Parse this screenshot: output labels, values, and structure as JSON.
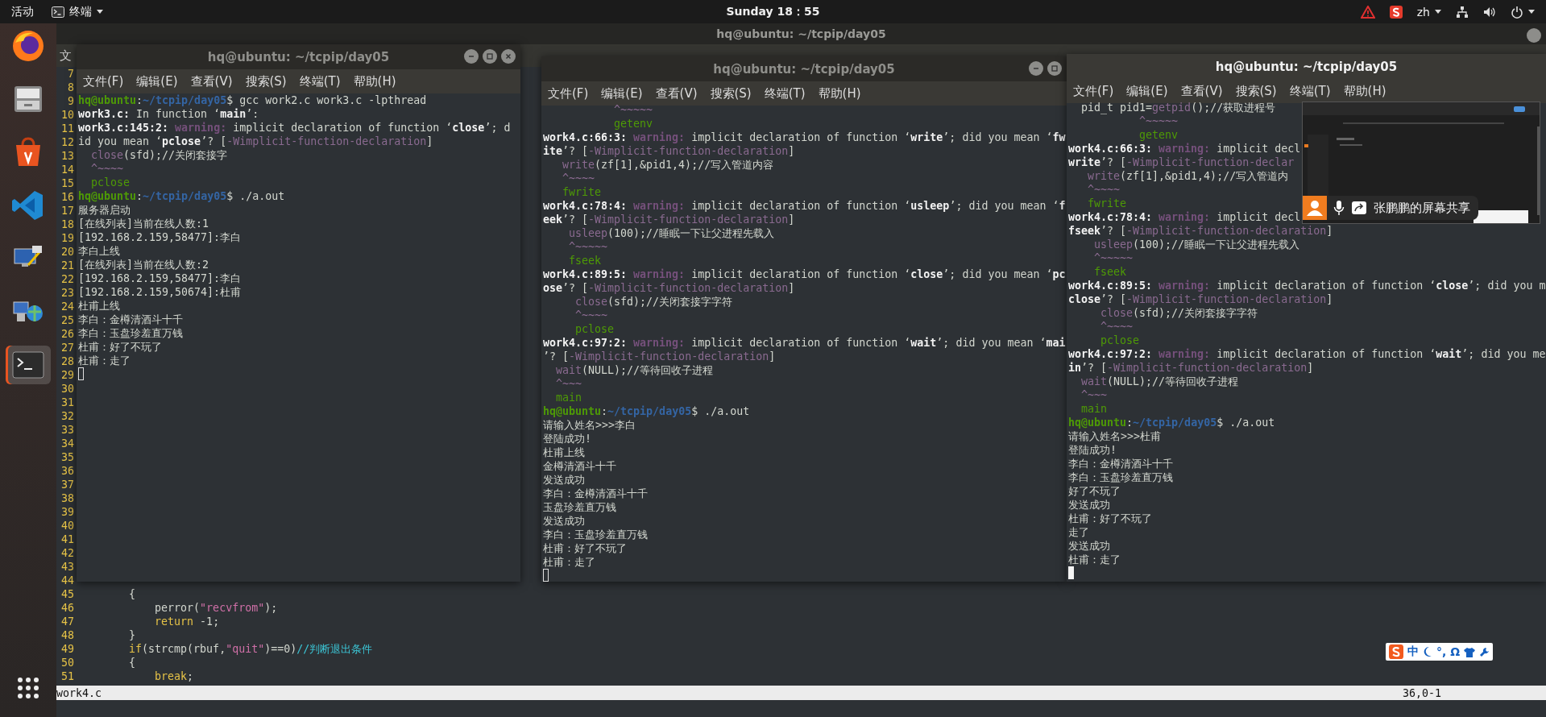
{
  "top_bar": {
    "activities": "活动",
    "app_name": "终端",
    "clock": "Sunday 18：55",
    "language": "zh"
  },
  "dock": [
    {
      "kind": "firefox",
      "running": false
    },
    {
      "kind": "files",
      "running": false
    },
    {
      "kind": "software",
      "running": false
    },
    {
      "kind": "vscode",
      "running": false
    },
    {
      "kind": "remote",
      "running": false
    },
    {
      "kind": "network",
      "running": false
    },
    {
      "kind": "terminal",
      "running": true
    }
  ],
  "editor": {
    "title": "hq@ubuntu: ~/tcpip/day05",
    "menu": [
      "文"
    ],
    "rows": [
      {
        "number": "7"
      },
      {
        "number": "8"
      },
      {
        "number": "9"
      },
      {
        "number": "10"
      },
      {
        "number": "11"
      },
      {
        "number": "12"
      },
      {
        "number": "13"
      },
      {
        "number": "14"
      },
      {
        "number": "15"
      },
      {
        "number": "16"
      },
      {
        "number": "17"
      },
      {
        "number": "18"
      },
      {
        "number": "19"
      },
      {
        "number": "20"
      },
      {
        "number": "21"
      },
      {
        "number": "22"
      },
      {
        "number": "23"
      },
      {
        "number": "24"
      },
      {
        "number": "25"
      },
      {
        "number": "26"
      },
      {
        "number": "27"
      },
      {
        "number": "28"
      },
      {
        "number": "29"
      },
      {
        "number": "30"
      },
      {
        "number": "31"
      },
      {
        "number": "32"
      },
      {
        "number": "33"
      },
      {
        "number": "34"
      },
      {
        "number": "35"
      },
      {
        "number": "36"
      },
      {
        "number": "37"
      },
      {
        "number": "38"
      },
      {
        "number": "39"
      },
      {
        "number": "40"
      },
      {
        "number": "41"
      },
      {
        "number": "42"
      },
      {
        "number": "43"
      },
      {
        "number": "44"
      },
      {
        "number": "45",
        "segments": [
          {
            "kind": "plain",
            "text": "        {"
          }
        ]
      },
      {
        "number": "46",
        "segments": [
          {
            "kind": "plain",
            "text": "            perror("
          },
          {
            "kind": "string",
            "text": "\"recvfrom\""
          },
          {
            "kind": "plain",
            "text": ");"
          }
        ]
      },
      {
        "number": "47",
        "segments": [
          {
            "kind": "keyword",
            "text": "            return"
          },
          {
            "kind": "plain",
            "text": " -1;"
          }
        ]
      },
      {
        "number": "48",
        "segments": [
          {
            "kind": "plain",
            "text": "        }"
          }
        ]
      },
      {
        "number": "49",
        "segments": [
          {
            "kind": "keyword",
            "text": "        if"
          },
          {
            "kind": "plain",
            "text": "(strcmp(rbuf,"
          },
          {
            "kind": "string",
            "text": "\"quit\""
          },
          {
            "kind": "plain",
            "text": ")==0)"
          },
          {
            "kind": "comment",
            "text": "//判断退出条件"
          }
        ]
      },
      {
        "number": "50",
        "segments": [
          {
            "kind": "plain",
            "text": "        {"
          }
        ]
      },
      {
        "number": "51",
        "segments": [
          {
            "kind": "keyword",
            "text": "            break"
          },
          {
            "kind": "plain",
            "text": ";"
          }
        ]
      }
    ],
    "status": {
      "file": "work4.c",
      "position": "36,0-1"
    }
  },
  "terminals": [
    {
      "title": "hq@ubuntu: ~/tcpip/day05",
      "active": false,
      "menu": [
        "文件(F)",
        "编辑(E)",
        "查看(V)",
        "搜索(S)",
        "终端(T)",
        "帮助(H)"
      ],
      "cursor_focused": false,
      "lines": [
        {
          "segments": [
            {
              "kind": "user",
              "text": "hq@ubuntu"
            },
            {
              "kind": "plain",
              "text": ":"
            },
            {
              "kind": "path",
              "text": "~/tcpip/day05"
            },
            {
              "kind": "plain",
              "text": "$ gcc work2.c work3.c -lpthread"
            }
          ]
        },
        {
          "segments": [
            {
              "kind": "bold",
              "text": "work3.c:"
            },
            {
              "kind": "plain",
              "text": " In function ‘"
            },
            {
              "kind": "bold",
              "text": "main"
            },
            {
              "kind": "plain",
              "text": "’:"
            }
          ]
        },
        {
          "segments": [
            {
              "kind": "bold",
              "text": "work3.c:145:2: "
            },
            {
              "kind": "warning",
              "text": "warning:"
            },
            {
              "kind": "plain",
              "text": " implicit declaration of function ‘"
            },
            {
              "kind": "bold",
              "text": "close"
            },
            {
              "kind": "plain",
              "text": "’; d"
            }
          ]
        },
        {
          "segments": [
            {
              "kind": "plain",
              "text": "id you mean ‘"
            },
            {
              "kind": "bold",
              "text": "pclose"
            },
            {
              "kind": "plain",
              "text": "’? ["
            },
            {
              "kind": "flag",
              "text": "-Wimplicit-function-declaration"
            },
            {
              "kind": "plain",
              "text": "]"
            }
          ]
        },
        {
          "segments": [
            {
              "kind": "flag",
              "text": "  close"
            },
            {
              "kind": "plain",
              "text": "(sfd);//关闭套接字"
            }
          ]
        },
        {
          "segments": [
            {
              "kind": "flag",
              "text": "  ^~~~~"
            }
          ]
        },
        {
          "segments": [
            {
              "kind": "hint",
              "text": "  pclose"
            }
          ]
        },
        {
          "segments": [
            {
              "kind": "user",
              "text": "hq@ubuntu"
            },
            {
              "kind": "plain",
              "text": ":"
            },
            {
              "kind": "path",
              "text": "~/tcpip/day05"
            },
            {
              "kind": "plain",
              "text": "$ ./a.out"
            }
          ]
        },
        {
          "segments": [
            {
              "kind": "plain",
              "text": "服务器启动"
            }
          ]
        },
        {
          "segments": [
            {
              "kind": "plain",
              "text": "[在线列表]当前在线人数:1"
            }
          ]
        },
        {
          "segments": [
            {
              "kind": "plain",
              "text": "[192.168.2.159,58477]:李白"
            }
          ]
        },
        {
          "segments": [
            {
              "kind": "plain",
              "text": "李白上线"
            }
          ]
        },
        {
          "segments": [
            {
              "kind": "plain",
              "text": "[在线列表]当前在线人数:2"
            }
          ]
        },
        {
          "segments": [
            {
              "kind": "plain",
              "text": "[192.168.2.159,58477]:李白"
            }
          ]
        },
        {
          "segments": [
            {
              "kind": "plain",
              "text": "[192.168.2.159,50674]:杜甫"
            }
          ]
        },
        {
          "segments": [
            {
              "kind": "plain",
              "text": "杜甫上线"
            }
          ]
        },
        {
          "segments": [
            {
              "kind": "plain",
              "text": "李白：金樽清酒斗十千"
            }
          ]
        },
        {
          "segments": [
            {
              "kind": "plain",
              "text": "李白：玉盘珍羞直万钱"
            }
          ]
        },
        {
          "segments": [
            {
              "kind": "plain",
              "text": "杜甫：好了不玩了"
            }
          ]
        },
        {
          "segments": [
            {
              "kind": "plain",
              "text": "杜甫：走了"
            }
          ]
        }
      ]
    },
    {
      "title": "hq@ubuntu: ~/tcpip/day05",
      "active": false,
      "menu": [
        "文件(F)",
        "编辑(E)",
        "查看(V)",
        "搜索(S)",
        "终端(T)",
        "帮助(H)"
      ],
      "cursor_focused": false,
      "lines": [
        {
          "segments": [
            {
              "kind": "flag",
              "text": "           ^~~~~~"
            }
          ]
        },
        {
          "segments": [
            {
              "kind": "hint",
              "text": "           getenv"
            }
          ]
        },
        {
          "segments": [
            {
              "kind": "bold",
              "text": "work4.c:66:3: "
            },
            {
              "kind": "warning",
              "text": "warning:"
            },
            {
              "kind": "plain",
              "text": " implicit declaration of function ‘"
            },
            {
              "kind": "bold",
              "text": "write"
            },
            {
              "kind": "plain",
              "text": "’; did you mean ‘"
            },
            {
              "kind": "bold",
              "text": "fw"
            }
          ]
        },
        {
          "segments": [
            {
              "kind": "bold",
              "text": "ite"
            },
            {
              "kind": "plain",
              "text": "’? ["
            },
            {
              "kind": "flag",
              "text": "-Wimplicit-function-declaration"
            },
            {
              "kind": "plain",
              "text": "]"
            }
          ]
        },
        {
          "segments": [
            {
              "kind": "flag",
              "text": "   write"
            },
            {
              "kind": "plain",
              "text": "(zf[1],&pid1,4);//写入管道内容"
            }
          ]
        },
        {
          "segments": [
            {
              "kind": "flag",
              "text": "   ^~~~~"
            }
          ]
        },
        {
          "segments": [
            {
              "kind": "hint",
              "text": "   fwrite"
            }
          ]
        },
        {
          "segments": [
            {
              "kind": "bold",
              "text": "work4.c:78:4: "
            },
            {
              "kind": "warning",
              "text": "warning:"
            },
            {
              "kind": "plain",
              "text": " implicit declaration of function ‘"
            },
            {
              "kind": "bold",
              "text": "usleep"
            },
            {
              "kind": "plain",
              "text": "’; did you mean ‘"
            },
            {
              "kind": "bold",
              "text": "f"
            }
          ]
        },
        {
          "segments": [
            {
              "kind": "bold",
              "text": "eek"
            },
            {
              "kind": "plain",
              "text": "’? ["
            },
            {
              "kind": "flag",
              "text": "-Wimplicit-function-declaration"
            },
            {
              "kind": "plain",
              "text": "]"
            }
          ]
        },
        {
          "segments": [
            {
              "kind": "flag",
              "text": "    usleep"
            },
            {
              "kind": "plain",
              "text": "(100);//睡眠一下让父进程先载入"
            }
          ]
        },
        {
          "segments": [
            {
              "kind": "flag",
              "text": "    ^~~~~~"
            }
          ]
        },
        {
          "segments": [
            {
              "kind": "hint",
              "text": "    fseek"
            }
          ]
        },
        {
          "segments": [
            {
              "kind": "bold",
              "text": "work4.c:89:5: "
            },
            {
              "kind": "warning",
              "text": "warning:"
            },
            {
              "kind": "plain",
              "text": " implicit declaration of function ‘"
            },
            {
              "kind": "bold",
              "text": "close"
            },
            {
              "kind": "plain",
              "text": "’; did you mean ‘"
            },
            {
              "kind": "bold",
              "text": "pc"
            }
          ]
        },
        {
          "segments": [
            {
              "kind": "bold",
              "text": "ose"
            },
            {
              "kind": "plain",
              "text": "’? ["
            },
            {
              "kind": "flag",
              "text": "-Wimplicit-function-declaration"
            },
            {
              "kind": "plain",
              "text": "]"
            }
          ]
        },
        {
          "segments": [
            {
              "kind": "flag",
              "text": "     close"
            },
            {
              "kind": "plain",
              "text": "(sfd);//关闭套接字字符"
            }
          ]
        },
        {
          "segments": [
            {
              "kind": "flag",
              "text": "     ^~~~~"
            }
          ]
        },
        {
          "segments": [
            {
              "kind": "hint",
              "text": "     pclose"
            }
          ]
        },
        {
          "segments": [
            {
              "kind": "bold",
              "text": "work4.c:97:2: "
            },
            {
              "kind": "warning",
              "text": "warning:"
            },
            {
              "kind": "plain",
              "text": " implicit declaration of function ‘"
            },
            {
              "kind": "bold",
              "text": "wait"
            },
            {
              "kind": "plain",
              "text": "’; did you mean ‘"
            },
            {
              "kind": "bold",
              "text": "mai"
            }
          ]
        },
        {
          "segments": [
            {
              "kind": "plain",
              "text": "’? ["
            },
            {
              "kind": "flag",
              "text": "-Wimplicit-function-declaration"
            },
            {
              "kind": "plain",
              "text": "]"
            }
          ]
        },
        {
          "segments": [
            {
              "kind": "flag",
              "text": "  wait"
            },
            {
              "kind": "plain",
              "text": "(NULL);//等待回收子进程"
            }
          ]
        },
        {
          "segments": [
            {
              "kind": "flag",
              "text": "  ^~~~"
            }
          ]
        },
        {
          "segments": [
            {
              "kind": "hint",
              "text": "  main"
            }
          ]
        },
        {
          "segments": [
            {
              "kind": "user",
              "text": "hq@ubuntu"
            },
            {
              "kind": "plain",
              "text": ":"
            },
            {
              "kind": "path",
              "text": "~/tcpip/day05"
            },
            {
              "kind": "plain",
              "text": "$ ./a.out"
            }
          ]
        },
        {
          "segments": [
            {
              "kind": "plain",
              "text": "请输入姓名>>>李白"
            }
          ]
        },
        {
          "segments": [
            {
              "kind": "plain",
              "text": "登陆成功!"
            }
          ]
        },
        {
          "segments": [
            {
              "kind": "plain",
              "text": "杜甫上线"
            }
          ]
        },
        {
          "segments": [
            {
              "kind": "plain",
              "text": "金樽清酒斗十千"
            }
          ]
        },
        {
          "segments": [
            {
              "kind": "plain",
              "text": "发送成功"
            }
          ]
        },
        {
          "segments": [
            {
              "kind": "plain",
              "text": "李白：金樽清酒斗十千"
            }
          ]
        },
        {
          "segments": [
            {
              "kind": "plain",
              "text": "玉盘珍羞直万钱"
            }
          ]
        },
        {
          "segments": [
            {
              "kind": "plain",
              "text": "发送成功"
            }
          ]
        },
        {
          "segments": [
            {
              "kind": "plain",
              "text": "李白：玉盘珍羞直万钱"
            }
          ]
        },
        {
          "segments": [
            {
              "kind": "plain",
              "text": "杜甫：好了不玩了"
            }
          ]
        },
        {
          "segments": [
            {
              "kind": "plain",
              "text": "杜甫：走了"
            }
          ]
        }
      ]
    },
    {
      "title": "hq@ubuntu: ~/tcpip/day05",
      "active": true,
      "menu": [
        "文件(F)",
        "编辑(E)",
        "查看(V)",
        "搜索(S)",
        "终端(T)",
        "帮助(H)"
      ],
      "cursor_focused": true,
      "lines": [
        {
          "segments": [
            {
              "kind": "plain",
              "text": "  pid_t pid1="
            },
            {
              "kind": "flag",
              "text": "getpid"
            },
            {
              "kind": "plain",
              "text": "();//获取进程号"
            }
          ]
        },
        {
          "segments": [
            {
              "kind": "flag",
              "text": "           ^~~~~~"
            }
          ]
        },
        {
          "segments": [
            {
              "kind": "hint",
              "text": "           getenv"
            }
          ]
        },
        {
          "segments": [
            {
              "kind": "bold",
              "text": "work4.c:66:3: "
            },
            {
              "kind": "warning",
              "text": "warning:"
            },
            {
              "kind": "plain",
              "text": " implicit decl"
            }
          ]
        },
        {
          "segments": [
            {
              "kind": "bold",
              "text": "write"
            },
            {
              "kind": "plain",
              "text": "’? ["
            },
            {
              "kind": "flag",
              "text": "-Wimplicit-function-declar"
            }
          ]
        },
        {
          "segments": [
            {
              "kind": "flag",
              "text": "   write"
            },
            {
              "kind": "plain",
              "text": "(zf[1],&pid1,4);//写入管道内"
            }
          ]
        },
        {
          "segments": [
            {
              "kind": "flag",
              "text": "   ^~~~~"
            }
          ]
        },
        {
          "segments": [
            {
              "kind": "hint",
              "text": "   fwrite"
            }
          ]
        },
        {
          "segments": [
            {
              "kind": "bold",
              "text": "work4.c:78:4: "
            },
            {
              "kind": "warning",
              "text": "warning:"
            },
            {
              "kind": "plain",
              "text": " implicit decl"
            }
          ]
        },
        {
          "segments": [
            {
              "kind": "bold",
              "text": "fseek"
            },
            {
              "kind": "plain",
              "text": "’? ["
            },
            {
              "kind": "flag",
              "text": "-Wimplicit-function-declaration"
            },
            {
              "kind": "plain",
              "text": "]"
            }
          ]
        },
        {
          "segments": [
            {
              "kind": "flag",
              "text": "    usleep"
            },
            {
              "kind": "plain",
              "text": "(100);//睡眠一下让父进程先载入"
            }
          ]
        },
        {
          "segments": [
            {
              "kind": "flag",
              "text": "    ^~~~~~"
            }
          ]
        },
        {
          "segments": [
            {
              "kind": "hint",
              "text": "    fseek"
            }
          ]
        },
        {
          "segments": [
            {
              "kind": "bold",
              "text": "work4.c:89:5: "
            },
            {
              "kind": "warning",
              "text": "warning:"
            },
            {
              "kind": "plain",
              "text": " implicit declaration of function ‘"
            },
            {
              "kind": "bold",
              "text": "close"
            },
            {
              "kind": "plain",
              "text": "’; did you m"
            }
          ]
        },
        {
          "segments": [
            {
              "kind": "bold",
              "text": "close"
            },
            {
              "kind": "plain",
              "text": "’? ["
            },
            {
              "kind": "flag",
              "text": "-Wimplicit-function-declaration"
            },
            {
              "kind": "plain",
              "text": "]"
            }
          ]
        },
        {
          "segments": [
            {
              "kind": "flag",
              "text": "     close"
            },
            {
              "kind": "plain",
              "text": "(sfd);//关闭套接字字符"
            }
          ]
        },
        {
          "segments": [
            {
              "kind": "flag",
              "text": "     ^~~~~"
            }
          ]
        },
        {
          "segments": [
            {
              "kind": "hint",
              "text": "     pclose"
            }
          ]
        },
        {
          "segments": [
            {
              "kind": "bold",
              "text": "work4.c:97:2: "
            },
            {
              "kind": "warning",
              "text": "warning:"
            },
            {
              "kind": "plain",
              "text": " implicit declaration of function ‘"
            },
            {
              "kind": "bold",
              "text": "wait"
            },
            {
              "kind": "plain",
              "text": "’; did you me"
            }
          ]
        },
        {
          "segments": [
            {
              "kind": "bold",
              "text": "in"
            },
            {
              "kind": "plain",
              "text": "’? ["
            },
            {
              "kind": "flag",
              "text": "-Wimplicit-function-declaration"
            },
            {
              "kind": "plain",
              "text": "]"
            }
          ]
        },
        {
          "segments": [
            {
              "kind": "flag",
              "text": "  wait"
            },
            {
              "kind": "plain",
              "text": "(NULL);//等待回收子进程"
            }
          ]
        },
        {
          "segments": [
            {
              "kind": "flag",
              "text": "  ^~~~"
            }
          ]
        },
        {
          "segments": [
            {
              "kind": "hint",
              "text": "  main"
            }
          ]
        },
        {
          "segments": [
            {
              "kind": "user",
              "text": "hq@ubuntu"
            },
            {
              "kind": "plain",
              "text": ":"
            },
            {
              "kind": "path",
              "text": "~/tcpip/day05"
            },
            {
              "kind": "plain",
              "text": "$ ./a.out"
            }
          ]
        },
        {
          "segments": [
            {
              "kind": "plain",
              "text": "请输入姓名>>>杜甫"
            }
          ]
        },
        {
          "segments": [
            {
              "kind": "plain",
              "text": "登陆成功!"
            }
          ]
        },
        {
          "segments": [
            {
              "kind": "plain",
              "text": "李白：金樽清酒斗十千"
            }
          ]
        },
        {
          "segments": [
            {
              "kind": "plain",
              "text": "李白：玉盘珍羞直万钱"
            }
          ]
        },
        {
          "segments": [
            {
              "kind": "plain",
              "text": "好了不玩了"
            }
          ]
        },
        {
          "segments": [
            {
              "kind": "plain",
              "text": "发送成功"
            }
          ]
        },
        {
          "segments": [
            {
              "kind": "plain",
              "text": "杜甫：好了不玩了"
            }
          ]
        },
        {
          "segments": [
            {
              "kind": "plain",
              "text": "走了"
            }
          ]
        },
        {
          "segments": [
            {
              "kind": "plain",
              "text": "发送成功"
            }
          ]
        },
        {
          "segments": [
            {
              "kind": "plain",
              "text": "杜甫：走了"
            }
          ]
        }
      ]
    }
  ],
  "screen_share": {
    "label": "张鹏鹏的屏幕共享"
  },
  "ime_toolbar": {
    "mode": "中",
    "symbols": [
      "°,",
      "Ω"
    ]
  }
}
